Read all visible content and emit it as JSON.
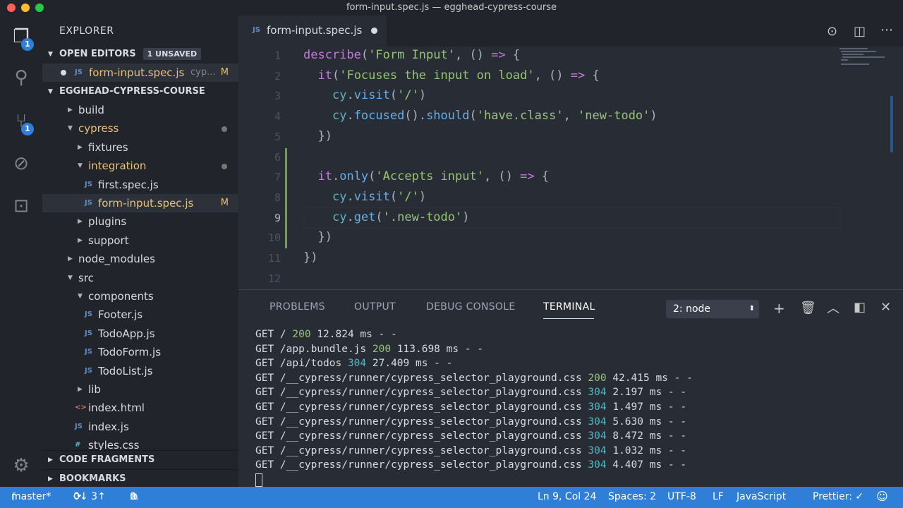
{
  "window": {
    "title": "form-input.spec.js — egghead-cypress-course"
  },
  "activity": {
    "explorer_badge": "1",
    "scm_badge": "1"
  },
  "sidebar": {
    "title": "EXPLORER",
    "open_editors": {
      "label": "OPEN EDITORS",
      "unsaved": "1 UNSAVED",
      "file": "form-input.spec.js",
      "path": "cyp...",
      "status": "M"
    },
    "project": "EGGHEAD-CYPRESS-COURSE",
    "tree": [
      {
        "name": "build",
        "status": ""
      },
      {
        "name": "cypress",
        "status": ""
      },
      {
        "name": "fixtures",
        "status": ""
      },
      {
        "name": "integration",
        "status": ""
      },
      {
        "name": "first.spec.js",
        "status": ""
      },
      {
        "name": "form-input.spec.js",
        "status": "M"
      },
      {
        "name": "plugins",
        "status": ""
      },
      {
        "name": "support",
        "status": ""
      },
      {
        "name": "node_modules",
        "status": ""
      },
      {
        "name": "src",
        "status": ""
      },
      {
        "name": "components",
        "status": ""
      },
      {
        "name": "Footer.js",
        "status": ""
      },
      {
        "name": "TodoApp.js",
        "status": ""
      },
      {
        "name": "TodoForm.js",
        "status": ""
      },
      {
        "name": "TodoList.js",
        "status": ""
      },
      {
        "name": "lib",
        "status": ""
      },
      {
        "name": "index.html",
        "status": ""
      },
      {
        "name": "index.js",
        "status": ""
      },
      {
        "name": "styles.css",
        "status": ""
      }
    ],
    "code_fragments": "CODE FRAGMENTS",
    "bookmarks": "BOOKMARKS"
  },
  "editor": {
    "tab": "form-input.spec.js",
    "line_numbers": [
      "1",
      "2",
      "3",
      "4",
      "5",
      "6",
      "7",
      "8",
      "9",
      "10",
      "11",
      "12"
    ],
    "lines": [
      "describe('Form Input', () => {",
      "  it('Focuses the input on load', () => {",
      "    cy.visit('/')",
      "    cy.focused().should('have.class', 'new-todo')",
      "  })",
      "",
      "  it.only('Accepts input', () => {",
      "    cy.visit('/')",
      "    cy.get('.new-todo')",
      "  })",
      "})",
      ""
    ]
  },
  "panel": {
    "tabs": [
      "PROBLEMS",
      "OUTPUT",
      "DEBUG CONSOLE",
      "TERMINAL"
    ],
    "terminal_select": "2: node",
    "terminal": [
      {
        "prefix": "GET / ",
        "code": "200",
        "suffix": " 12.824 ms - -"
      },
      {
        "prefix": "GET /app.bundle.js ",
        "code": "200",
        "suffix": " 113.698 ms - -"
      },
      {
        "prefix": "GET /api/todos ",
        "code": "304",
        "suffix": " 27.409 ms - -"
      },
      {
        "prefix": "GET /__cypress/runner/cypress_selector_playground.css ",
        "code": "200",
        "suffix": " 42.415 ms - -"
      },
      {
        "prefix": "GET /__cypress/runner/cypress_selector_playground.css ",
        "code": "304",
        "suffix": " 2.197 ms - -"
      },
      {
        "prefix": "GET /__cypress/runner/cypress_selector_playground.css ",
        "code": "304",
        "suffix": " 1.497 ms - -"
      },
      {
        "prefix": "GET /__cypress/runner/cypress_selector_playground.css ",
        "code": "304",
        "suffix": " 5.630 ms - -"
      },
      {
        "prefix": "GET /__cypress/runner/cypress_selector_playground.css ",
        "code": "304",
        "suffix": " 8.472 ms - -"
      },
      {
        "prefix": "GET /__cypress/runner/cypress_selector_playground.css ",
        "code": "304",
        "suffix": " 1.032 ms - -"
      },
      {
        "prefix": "GET /__cypress/runner/cypress_selector_playground.css ",
        "code": "304",
        "suffix": " 4.407 ms - -"
      }
    ]
  },
  "status": {
    "branch": "master*",
    "sync": "0↓ 3↑",
    "errors": "0",
    "warnings": "0",
    "position": "Ln 9, Col 24",
    "spaces": "Spaces: 2",
    "encoding": "UTF-8",
    "eol": "LF",
    "language": "JavaScript",
    "prettier": "Prettier: ✓"
  },
  "colors": {
    "accent": "#2f7fd8",
    "ok": "#98c379",
    "not_modified": "#56b6c2"
  }
}
